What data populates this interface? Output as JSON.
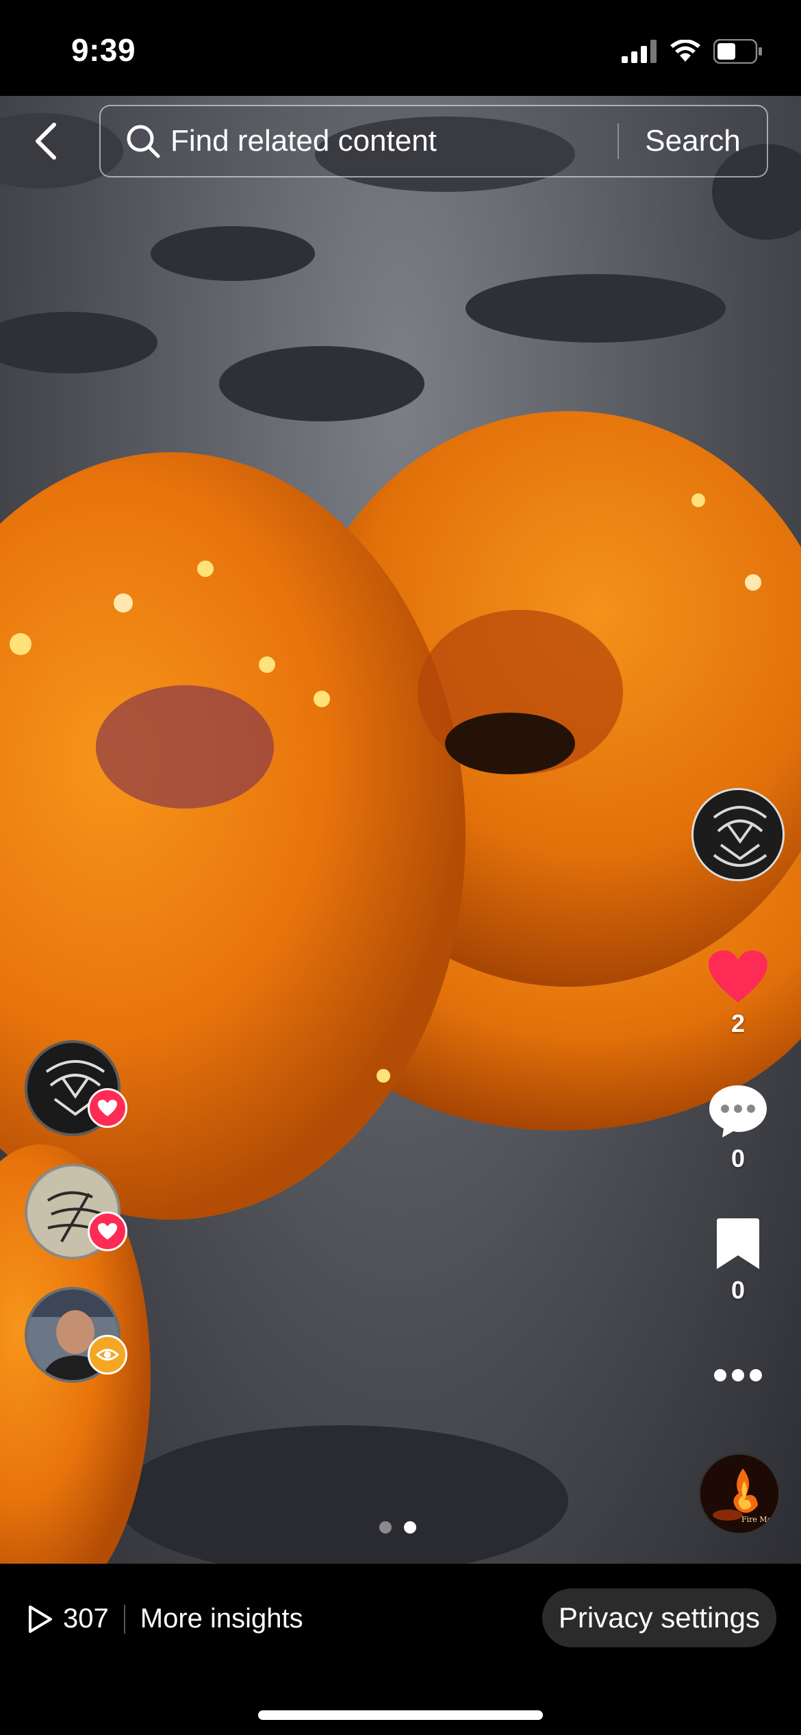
{
  "status_bar": {
    "time": "9:39"
  },
  "search": {
    "placeholder": "Find related content",
    "button_label": "Search"
  },
  "rail": {
    "likes_count": "2",
    "comments_count": "0",
    "saves_count": "0"
  },
  "left_stack": [
    {
      "badge": "heart-icon",
      "badge_color": "#fe2c55"
    },
    {
      "badge": "heart-icon",
      "badge_color": "#fe2c55"
    },
    {
      "badge": "eye-icon",
      "badge_color": "#f5a623"
    }
  ],
  "music_disc": {
    "caption": "Fire Maya Sar"
  },
  "pagination": {
    "total": 2,
    "active": 2
  },
  "bottom": {
    "views_count": "307",
    "insights_label": "More insights",
    "privacy_label": "Privacy settings"
  },
  "colors": {
    "like": "#fe2c55",
    "eye_badge": "#f5a623",
    "video_orange": "#e8740c"
  }
}
